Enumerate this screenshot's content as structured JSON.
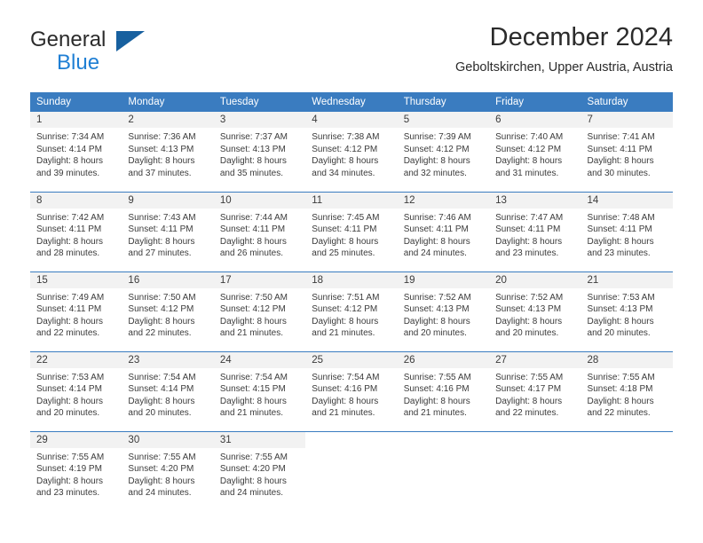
{
  "brand": {
    "line1": "General",
    "line2": "Blue",
    "logo_icon": "triangle-icon",
    "color_dark": "#2b2b2b",
    "color_blue": "#1f7fd4",
    "color_triangle": "#17609f"
  },
  "header": {
    "title": "December 2024",
    "location": "Geboltskirchen, Upper Austria, Austria"
  },
  "colors": {
    "header_row_bg": "#3a7cc0",
    "header_row_text": "#ffffff",
    "daynum_bg": "#f2f2f2",
    "cell_text": "#3b3b3b",
    "rule": "#3a7cc0"
  },
  "weekday_headers": [
    "Sunday",
    "Monday",
    "Tuesday",
    "Wednesday",
    "Thursday",
    "Friday",
    "Saturday"
  ],
  "weeks": [
    [
      {
        "day": "1",
        "sunrise": "Sunrise: 7:34 AM",
        "sunset": "Sunset: 4:14 PM",
        "daylight1": "Daylight: 8 hours",
        "daylight2": "and 39 minutes."
      },
      {
        "day": "2",
        "sunrise": "Sunrise: 7:36 AM",
        "sunset": "Sunset: 4:13 PM",
        "daylight1": "Daylight: 8 hours",
        "daylight2": "and 37 minutes."
      },
      {
        "day": "3",
        "sunrise": "Sunrise: 7:37 AM",
        "sunset": "Sunset: 4:13 PM",
        "daylight1": "Daylight: 8 hours",
        "daylight2": "and 35 minutes."
      },
      {
        "day": "4",
        "sunrise": "Sunrise: 7:38 AM",
        "sunset": "Sunset: 4:12 PM",
        "daylight1": "Daylight: 8 hours",
        "daylight2": "and 34 minutes."
      },
      {
        "day": "5",
        "sunrise": "Sunrise: 7:39 AM",
        "sunset": "Sunset: 4:12 PM",
        "daylight1": "Daylight: 8 hours",
        "daylight2": "and 32 minutes."
      },
      {
        "day": "6",
        "sunrise": "Sunrise: 7:40 AM",
        "sunset": "Sunset: 4:12 PM",
        "daylight1": "Daylight: 8 hours",
        "daylight2": "and 31 minutes."
      },
      {
        "day": "7",
        "sunrise": "Sunrise: 7:41 AM",
        "sunset": "Sunset: 4:11 PM",
        "daylight1": "Daylight: 8 hours",
        "daylight2": "and 30 minutes."
      }
    ],
    [
      {
        "day": "8",
        "sunrise": "Sunrise: 7:42 AM",
        "sunset": "Sunset: 4:11 PM",
        "daylight1": "Daylight: 8 hours",
        "daylight2": "and 28 minutes."
      },
      {
        "day": "9",
        "sunrise": "Sunrise: 7:43 AM",
        "sunset": "Sunset: 4:11 PM",
        "daylight1": "Daylight: 8 hours",
        "daylight2": "and 27 minutes."
      },
      {
        "day": "10",
        "sunrise": "Sunrise: 7:44 AM",
        "sunset": "Sunset: 4:11 PM",
        "daylight1": "Daylight: 8 hours",
        "daylight2": "and 26 minutes."
      },
      {
        "day": "11",
        "sunrise": "Sunrise: 7:45 AM",
        "sunset": "Sunset: 4:11 PM",
        "daylight1": "Daylight: 8 hours",
        "daylight2": "and 25 minutes."
      },
      {
        "day": "12",
        "sunrise": "Sunrise: 7:46 AM",
        "sunset": "Sunset: 4:11 PM",
        "daylight1": "Daylight: 8 hours",
        "daylight2": "and 24 minutes."
      },
      {
        "day": "13",
        "sunrise": "Sunrise: 7:47 AM",
        "sunset": "Sunset: 4:11 PM",
        "daylight1": "Daylight: 8 hours",
        "daylight2": "and 23 minutes."
      },
      {
        "day": "14",
        "sunrise": "Sunrise: 7:48 AM",
        "sunset": "Sunset: 4:11 PM",
        "daylight1": "Daylight: 8 hours",
        "daylight2": "and 23 minutes."
      }
    ],
    [
      {
        "day": "15",
        "sunrise": "Sunrise: 7:49 AM",
        "sunset": "Sunset: 4:11 PM",
        "daylight1": "Daylight: 8 hours",
        "daylight2": "and 22 minutes."
      },
      {
        "day": "16",
        "sunrise": "Sunrise: 7:50 AM",
        "sunset": "Sunset: 4:12 PM",
        "daylight1": "Daylight: 8 hours",
        "daylight2": "and 22 minutes."
      },
      {
        "day": "17",
        "sunrise": "Sunrise: 7:50 AM",
        "sunset": "Sunset: 4:12 PM",
        "daylight1": "Daylight: 8 hours",
        "daylight2": "and 21 minutes."
      },
      {
        "day": "18",
        "sunrise": "Sunrise: 7:51 AM",
        "sunset": "Sunset: 4:12 PM",
        "daylight1": "Daylight: 8 hours",
        "daylight2": "and 21 minutes."
      },
      {
        "day": "19",
        "sunrise": "Sunrise: 7:52 AM",
        "sunset": "Sunset: 4:13 PM",
        "daylight1": "Daylight: 8 hours",
        "daylight2": "and 20 minutes."
      },
      {
        "day": "20",
        "sunrise": "Sunrise: 7:52 AM",
        "sunset": "Sunset: 4:13 PM",
        "daylight1": "Daylight: 8 hours",
        "daylight2": "and 20 minutes."
      },
      {
        "day": "21",
        "sunrise": "Sunrise: 7:53 AM",
        "sunset": "Sunset: 4:13 PM",
        "daylight1": "Daylight: 8 hours",
        "daylight2": "and 20 minutes."
      }
    ],
    [
      {
        "day": "22",
        "sunrise": "Sunrise: 7:53 AM",
        "sunset": "Sunset: 4:14 PM",
        "daylight1": "Daylight: 8 hours",
        "daylight2": "and 20 minutes."
      },
      {
        "day": "23",
        "sunrise": "Sunrise: 7:54 AM",
        "sunset": "Sunset: 4:14 PM",
        "daylight1": "Daylight: 8 hours",
        "daylight2": "and 20 minutes."
      },
      {
        "day": "24",
        "sunrise": "Sunrise: 7:54 AM",
        "sunset": "Sunset: 4:15 PM",
        "daylight1": "Daylight: 8 hours",
        "daylight2": "and 21 minutes."
      },
      {
        "day": "25",
        "sunrise": "Sunrise: 7:54 AM",
        "sunset": "Sunset: 4:16 PM",
        "daylight1": "Daylight: 8 hours",
        "daylight2": "and 21 minutes."
      },
      {
        "day": "26",
        "sunrise": "Sunrise: 7:55 AM",
        "sunset": "Sunset: 4:16 PM",
        "daylight1": "Daylight: 8 hours",
        "daylight2": "and 21 minutes."
      },
      {
        "day": "27",
        "sunrise": "Sunrise: 7:55 AM",
        "sunset": "Sunset: 4:17 PM",
        "daylight1": "Daylight: 8 hours",
        "daylight2": "and 22 minutes."
      },
      {
        "day": "28",
        "sunrise": "Sunrise: 7:55 AM",
        "sunset": "Sunset: 4:18 PM",
        "daylight1": "Daylight: 8 hours",
        "daylight2": "and 22 minutes."
      }
    ],
    [
      {
        "day": "29",
        "sunrise": "Sunrise: 7:55 AM",
        "sunset": "Sunset: 4:19 PM",
        "daylight1": "Daylight: 8 hours",
        "daylight2": "and 23 minutes."
      },
      {
        "day": "30",
        "sunrise": "Sunrise: 7:55 AM",
        "sunset": "Sunset: 4:20 PM",
        "daylight1": "Daylight: 8 hours",
        "daylight2": "and 24 minutes."
      },
      {
        "day": "31",
        "sunrise": "Sunrise: 7:55 AM",
        "sunset": "Sunset: 4:20 PM",
        "daylight1": "Daylight: 8 hours",
        "daylight2": "and 24 minutes."
      },
      {
        "day": "",
        "sunrise": "",
        "sunset": "",
        "daylight1": "",
        "daylight2": ""
      },
      {
        "day": "",
        "sunrise": "",
        "sunset": "",
        "daylight1": "",
        "daylight2": ""
      },
      {
        "day": "",
        "sunrise": "",
        "sunset": "",
        "daylight1": "",
        "daylight2": ""
      },
      {
        "day": "",
        "sunrise": "",
        "sunset": "",
        "daylight1": "",
        "daylight2": ""
      }
    ]
  ]
}
